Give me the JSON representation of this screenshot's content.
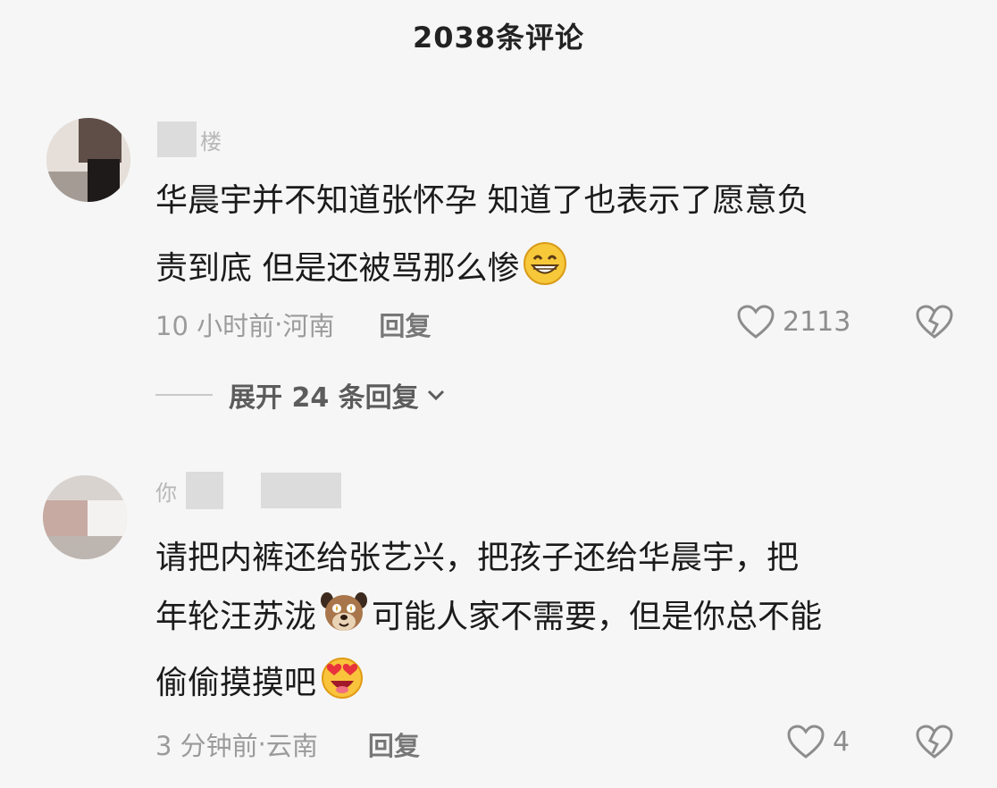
{
  "header": {
    "title": "2038条评论"
  },
  "comments": [
    {
      "username_fragment": "楼",
      "text_line1": "华晨宇并不知道张怀孕 知道了也表示了愿意负",
      "text_line2": "责到底 但是还被骂那么惨",
      "emoji": "grinning-face-emoji",
      "time": "10 小时前",
      "location": "河南",
      "reply_label": "回复",
      "likes": "2113",
      "expand_label": "展开 24 条回复"
    },
    {
      "username_fragment": "你",
      "text_line1": "请把内裤还给张艺兴，把孩子还给华晨宇，把",
      "text_line2_a": "年轮汪苏泷",
      "text_line2_b": "可能人家不需要，但是你总不能",
      "text_line3": "偷偷摸摸吧",
      "emoji_a": "dog-face-sticker",
      "emoji_b": "heart-eyes-emoji",
      "time": "3 分钟前",
      "location": "云南",
      "reply_label": "回复",
      "likes": "4"
    }
  ],
  "meta_separator": " · ",
  "icons": {
    "like": "heart-outline-icon",
    "dislike": "broken-heart-icon",
    "expand": "chevron-down-icon"
  },
  "colors": {
    "background": "#f6f6f6",
    "text": "#1b1b1b",
    "muted": "#9b9b9b"
  }
}
